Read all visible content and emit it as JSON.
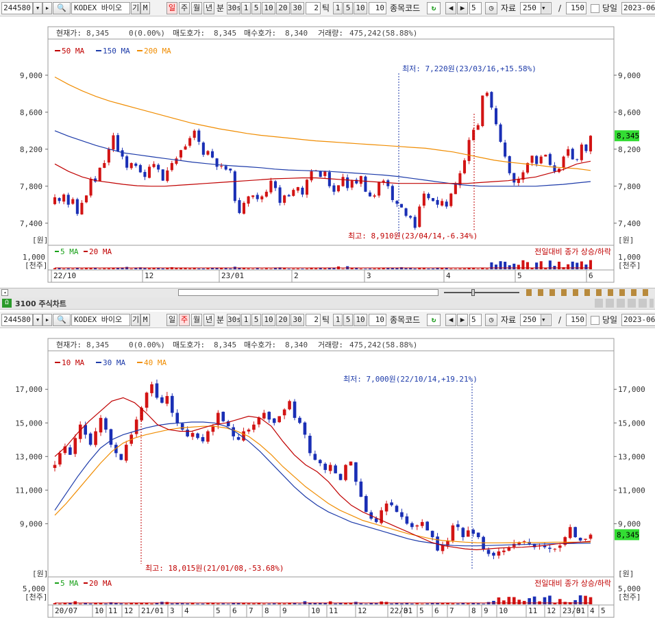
{
  "toolbar1": {
    "code": "244580",
    "name": "KODEX 바이오",
    "giho": "기",
    "m_label": "M",
    "periods": [
      "일",
      "주",
      "월",
      "년"
    ],
    "active_period_top": "일",
    "bun": "분",
    "bun_sel": "30s",
    "mins": [
      "1",
      "5",
      "10",
      "20",
      "30"
    ],
    "tick_value": "2",
    "tick_label": "틱",
    "ticks": [
      "1",
      "5",
      "10"
    ],
    "ten": "10",
    "jongmok": "종목코드",
    "num5": "5",
    "jaryo": "자료",
    "count": "250",
    "slash": "/",
    "total": "150",
    "dangil": "당일",
    "date": "2023-06-"
  },
  "toolbar2": {
    "code": "244580",
    "name": "KODEX 바이오",
    "giho": "기",
    "m_label": "M",
    "periods": [
      "일",
      "주",
      "월",
      "년"
    ],
    "active_period_bottom": "주",
    "bun": "분",
    "bun_sel": "30s",
    "mins": [
      "1",
      "5",
      "10",
      "20",
      "30"
    ],
    "tick_value": "2",
    "tick_label": "틱",
    "ticks": [
      "1",
      "5",
      "10"
    ],
    "ten": "10",
    "jongmok": "종목코드",
    "num5": "5",
    "jaryo": "자료",
    "count": "250",
    "slash": "/",
    "total": "150",
    "dangil": "당일",
    "date": "2023-06-"
  },
  "panel2_title": "3100 주식차트",
  "colors": {
    "up": "#d21414",
    "down": "#1a2fb5",
    "ma_short": "#c00000",
    "ma_mid": "#1c3aa9",
    "ma_long": "#f08c00",
    "green_badge": "#33dd33",
    "vol_green": "#18a018"
  },
  "chart_data": [
    {
      "type": "candlestick",
      "period": "daily",
      "info": {
        "cur_label": "현재가:",
        "cur": "8,345",
        "chg": "0(0.00%)",
        "ask_label": "매도호가:",
        "ask": "8,345",
        "bid_label": "매수호가:",
        "bid": "8,340",
        "vol_label": "거래량:",
        "vol": "475,242(58.88%)"
      },
      "legend": [
        {
          "name": "50 MA",
          "color": "#c00000"
        },
        {
          "name": "150 MA",
          "color": "#1c3aa9"
        },
        {
          "name": "200 MA",
          "color": "#f08c00"
        }
      ],
      "y_ticks": [
        "9,000",
        "8,600",
        "8,200",
        "7,800",
        "7,400"
      ],
      "y_unit": "[원]",
      "ylim": [
        7250,
        9250
      ],
      "last_price": "8,345",
      "ann_low": "최저: 7,220원(23/03/16,+15.58%)",
      "ann_high": "최고: 8,910원(23/04/14,-6.34%)",
      "vol_legend": [
        {
          "name": "5 MA",
          "color": "#18a018"
        },
        {
          "name": "20 MA",
          "color": "#c00000"
        }
      ],
      "vol_tick": "1,000",
      "vol_unit": "[천주]",
      "vol_note": "전일대비 종가 상승/하락",
      "x_ticks": [
        "22/10",
        "12",
        "23/01",
        "2",
        "3",
        "4",
        "5",
        "6"
      ],
      "closes": [
        7680,
        7640,
        7710,
        7600,
        7660,
        7500,
        7620,
        7700,
        7880,
        7850,
        8000,
        8050,
        8200,
        8350,
        8180,
        8120,
        8000,
        8050,
        8020,
        7950,
        7900,
        8010,
        8040,
        7980,
        7860,
        7970,
        8050,
        8100,
        8190,
        8230,
        8320,
        8400,
        8280,
        8140,
        8180,
        8110,
        8010,
        8020,
        7980,
        7970,
        7640,
        7510,
        7620,
        7690,
        7700,
        7660,
        7690,
        7740,
        7860,
        7780,
        7620,
        7700,
        7690,
        7760,
        7790,
        7710,
        7870,
        7960,
        7970,
        7900,
        7960,
        7800,
        7740,
        7810,
        7900,
        7780,
        7860,
        7830,
        7910,
        7740,
        7690,
        7700,
        7840,
        7860,
        7800,
        7650,
        7610,
        7570,
        7480,
        7460,
        7350,
        7580,
        7720,
        7670,
        7640,
        7600,
        7640,
        7580,
        7720,
        7820,
        7940,
        8080,
        8300,
        8410,
        8460,
        8780,
        8810,
        8650,
        8470,
        8280,
        8120,
        7940,
        7840,
        7880,
        7950,
        8050,
        8130,
        8040,
        8120,
        8140,
        8030,
        7960,
        7990,
        8120,
        8200,
        8090,
        8090,
        8250,
        8180,
        8345
      ],
      "ma50": [
        8040,
        7960,
        7900,
        7860,
        7840,
        7820,
        7805,
        7800,
        7800,
        7810,
        7820,
        7830,
        7840,
        7850,
        7860,
        7870,
        7880,
        7885,
        7890,
        7890,
        7880,
        7870,
        7860,
        7850,
        7840,
        7830,
        7830,
        7830,
        7830,
        7830,
        7830,
        7840,
        7850,
        7860,
        7880,
        7900,
        7940,
        7980,
        8040,
        8070
      ],
      "ma150": [
        8400,
        8340,
        8290,
        8240,
        8200,
        8160,
        8140,
        8120,
        8100,
        8080,
        8060,
        8045,
        8030,
        8020,
        8010,
        8000,
        7985,
        7975,
        7970,
        7965,
        7960,
        7950,
        7940,
        7930,
        7920,
        7905,
        7885,
        7865,
        7845,
        7825,
        7810,
        7800,
        7800,
        7800,
        7800,
        7800,
        7810,
        7820,
        7835,
        7850
      ],
      "ma200": [
        8980,
        8900,
        8830,
        8770,
        8720,
        8680,
        8640,
        8600,
        8560,
        8520,
        8480,
        8450,
        8420,
        8395,
        8370,
        8350,
        8335,
        8320,
        8305,
        8290,
        8280,
        8270,
        8260,
        8250,
        8240,
        8230,
        8220,
        8210,
        8190,
        8170,
        8140,
        8110,
        8080,
        8060,
        8045,
        8030,
        8010,
        8000,
        7990,
        7970
      ]
    },
    {
      "type": "candlestick",
      "period": "weekly",
      "info": {
        "cur_label": "현재가:",
        "cur": "8,345",
        "chg": "0(0.00%)",
        "ask_label": "매도호가:",
        "ask": "8,345",
        "bid_label": "매수호가:",
        "bid": "8,340",
        "vol_label": "거래량:",
        "vol": "475,242(58.88%)"
      },
      "legend": [
        {
          "name": "10 MA",
          "color": "#c00000"
        },
        {
          "name": "30 MA",
          "color": "#1c3aa9"
        },
        {
          "name": "40 MA",
          "color": "#f08c00"
        }
      ],
      "y_ticks": [
        "17,000",
        "15,000",
        "13,000",
        "11,000",
        "9,000"
      ],
      "y_unit": "[원]",
      "ylim": [
        6200,
        18600
      ],
      "last_price": "8,345",
      "ann_low": "최저: 7,000원(22/10/14,+19.21%)",
      "ann_high": "최고: 18,015원(21/01/08,-53.68%)",
      "vol_legend": [
        {
          "name": "5 MA",
          "color": "#18a018"
        },
        {
          "name": "20 MA",
          "color": "#c00000"
        }
      ],
      "vol_tick": "5,000",
      "vol_unit": "[천주]",
      "vol_note": "전일대비 종가 상승/하락",
      "x_ticks": [
        "20/07",
        "10",
        "11",
        "12",
        "21/01",
        "3",
        "4",
        "5",
        "6",
        "7",
        "8",
        "9",
        "10",
        "11",
        "12",
        "22/01",
        "3",
        "5",
        "6",
        "7",
        "8",
        "9",
        "10",
        "11",
        "12",
        "23/01",
        "3",
        "4",
        "5"
      ],
      "closes": [
        12500,
        13200,
        13600,
        13100,
        14100,
        14900,
        14300,
        13700,
        14500,
        15300,
        14600,
        13700,
        13200,
        12800,
        13700,
        14300,
        15200,
        15900,
        16800,
        17300,
        16500,
        16200,
        16600,
        15600,
        15000,
        14600,
        14200,
        14400,
        14100,
        13900,
        14500,
        14800,
        15600,
        15100,
        14800,
        14200,
        14000,
        14500,
        14600,
        14900,
        15300,
        15600,
        15200,
        15000,
        15400,
        15800,
        16300,
        15300,
        15000,
        14300,
        13200,
        12800,
        12600,
        12200,
        12500,
        12000,
        11600,
        12500,
        12700,
        11500,
        10600,
        9700,
        9300,
        9100,
        9800,
        10200,
        10100,
        9700,
        9400,
        9000,
        8800,
        8900,
        9100,
        8600,
        8200,
        7400,
        7700,
        8000,
        8900,
        8800,
        8200,
        8600,
        8400,
        8200,
        7500,
        7200,
        7100,
        7350,
        7400,
        7600,
        7800,
        7900,
        7950,
        7800,
        7600,
        7700,
        7600,
        7500,
        7500,
        7700,
        8200,
        8800,
        8200,
        8000,
        8100,
        8345
      ],
      "ma10": [
        13000,
        13600,
        14400,
        15100,
        15700,
        16300,
        16500,
        16200,
        15600,
        14900,
        14600,
        14500,
        14500,
        14700,
        14900,
        15000,
        15200,
        15400,
        15300,
        14800,
        13900,
        13100,
        12500,
        12100,
        11500,
        10700,
        10100,
        9700,
        9400,
        9100,
        8800,
        8500,
        8200,
        7900,
        7700,
        7600,
        7500,
        7450,
        7500,
        7550,
        7580,
        7600,
        7650,
        7700,
        7800,
        7850,
        7900,
        7950
      ],
      "ma30": [
        9800,
        10800,
        11800,
        12700,
        13500,
        14000,
        14300,
        14500,
        14700,
        14850,
        14950,
        15000,
        15050,
        15050,
        15000,
        14800,
        14400,
        13900,
        13300,
        12600,
        11900,
        11200,
        10600,
        10100,
        9700,
        9400,
        9100,
        8900,
        8700,
        8500,
        8300,
        8100,
        7950,
        7850,
        7750,
        7700,
        7680,
        7680,
        7700,
        7720,
        7740,
        7760,
        7780,
        7800,
        7810,
        7820,
        7830,
        7840
      ],
      "ma40": [
        9500,
        10200,
        11000,
        11800,
        12600,
        13300,
        13800,
        14100,
        14300,
        14450,
        14600,
        14700,
        14750,
        14800,
        14800,
        14700,
        14500,
        14200,
        13700,
        13100,
        12400,
        11800,
        11200,
        10700,
        10200,
        9800,
        9500,
        9200,
        9000,
        8800,
        8600,
        8400,
        8250,
        8100,
        8000,
        7950,
        7900,
        7870,
        7860,
        7860,
        7870,
        7880,
        7880,
        7890,
        7900,
        7900,
        7900,
        7910
      ]
    }
  ]
}
